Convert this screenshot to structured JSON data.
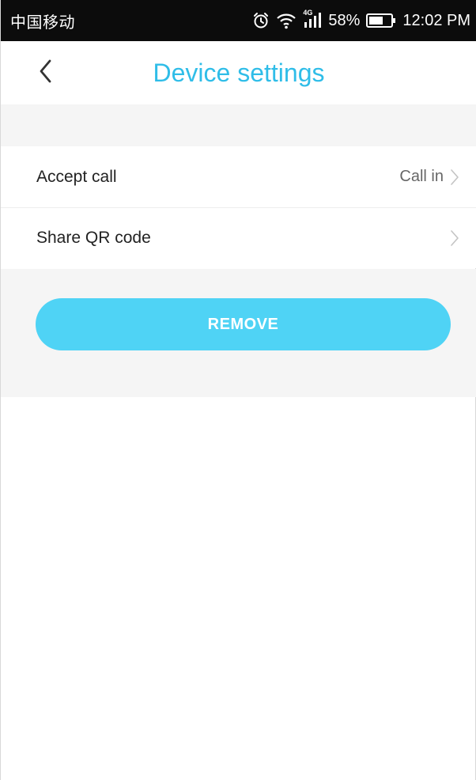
{
  "status_bar": {
    "carrier": "中国移动",
    "network": "4G",
    "battery": "58%",
    "time": "12:02 PM",
    "icons": [
      "alarm-icon",
      "wifi-icon",
      "signal-icon",
      "battery-icon"
    ]
  },
  "header": {
    "title": "Device settings",
    "back_icon": "chevron-left-icon"
  },
  "settings": {
    "items": [
      {
        "label": "Accept call",
        "value": "Call in"
      },
      {
        "label": "Share QR code",
        "value": ""
      }
    ]
  },
  "actions": {
    "remove_label": "REMOVE"
  },
  "colors": {
    "accent_title": "#2fbde8",
    "button": "#4fd3f5",
    "band": "#f5f5f5",
    "status_bar": "#0c0c0c"
  }
}
